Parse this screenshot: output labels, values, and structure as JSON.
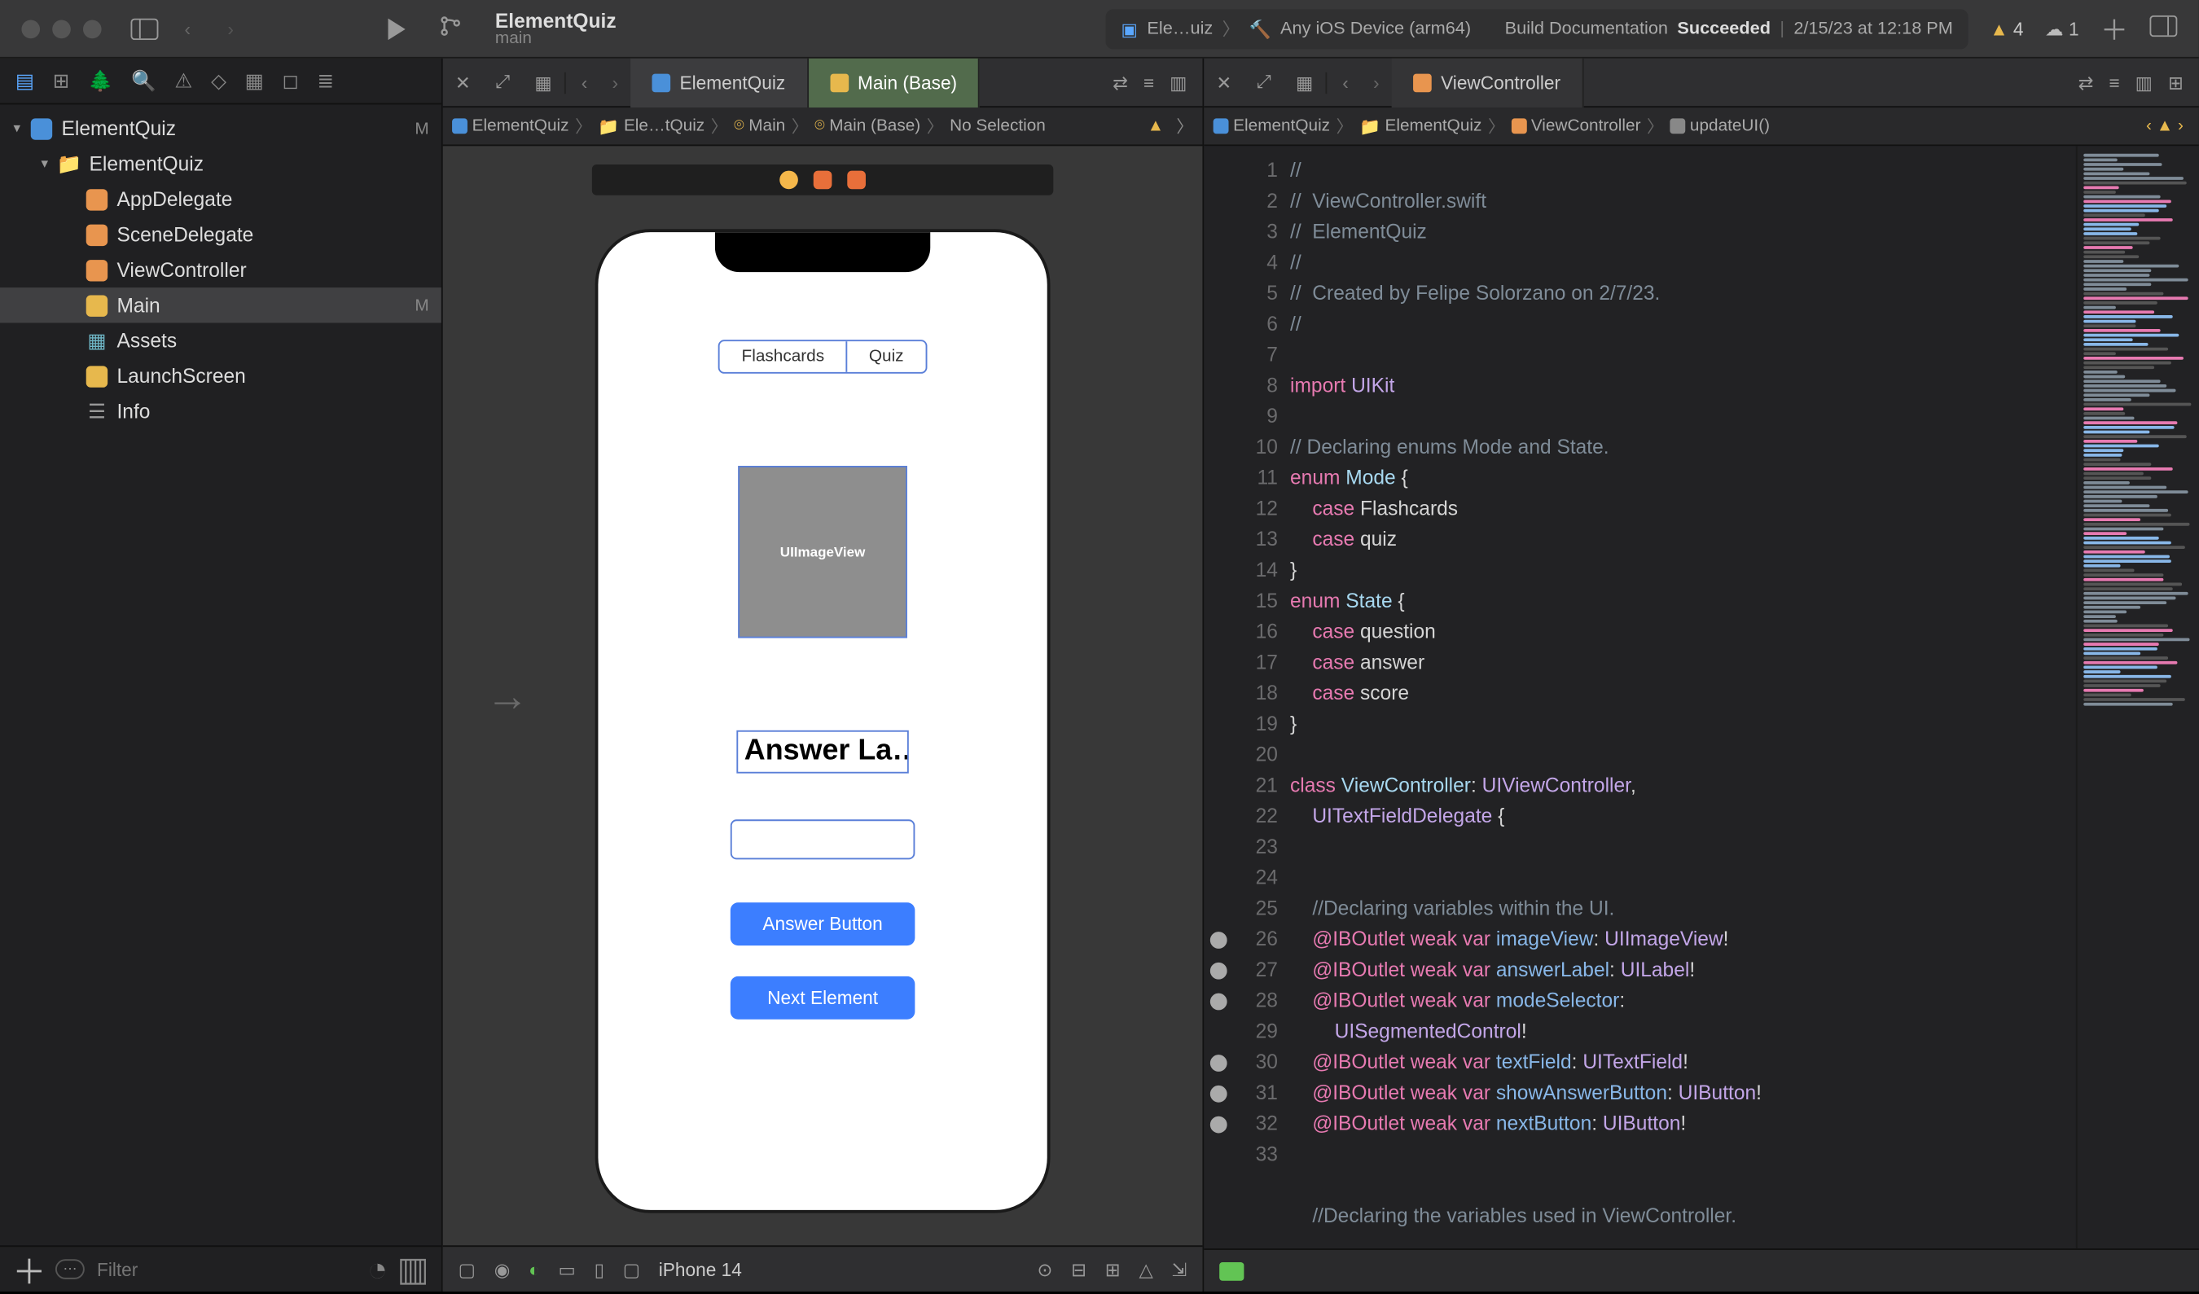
{
  "project": {
    "name": "ElementQuiz",
    "branch": "main"
  },
  "status": {
    "scheme": "Ele…uiz",
    "destination": "Any iOS Device (arm64)",
    "activity_pre": "Build Documentation ",
    "activity_strong": "Succeeded",
    "activity_time": "2/15/23 at 12:18 PM",
    "warnings": "4",
    "cloud": "1"
  },
  "navigator": {
    "rows": [
      {
        "label": "ElementQuiz",
        "indent": 0,
        "icon": "proj",
        "disclosure": "▾",
        "status": "M"
      },
      {
        "label": "ElementQuiz",
        "indent": 1,
        "icon": "fold",
        "disclosure": "▾",
        "status": ""
      },
      {
        "label": "AppDelegate",
        "indent": 2,
        "icon": "swift",
        "status": ""
      },
      {
        "label": "SceneDelegate",
        "indent": 2,
        "icon": "swift",
        "status": ""
      },
      {
        "label": "ViewController",
        "indent": 2,
        "icon": "swift",
        "status": ""
      },
      {
        "label": "Main",
        "indent": 2,
        "icon": "ib",
        "status": "M",
        "selected": true
      },
      {
        "label": "Assets",
        "indent": 2,
        "icon": "asset",
        "status": ""
      },
      {
        "label": "LaunchScreen",
        "indent": 2,
        "icon": "ib",
        "status": ""
      },
      {
        "label": "Info",
        "indent": 2,
        "icon": "plist",
        "status": ""
      }
    ],
    "filter_placeholder": "Filter"
  },
  "editor_left": {
    "tab_inactive": "ElementQuiz",
    "tab_active": "Main (Base)",
    "jump": [
      "ElementQuiz",
      "Ele…tQuiz",
      "Main",
      "Main (Base)",
      "No Selection"
    ],
    "phone": {
      "seg": [
        "Flashcards",
        "Quiz"
      ],
      "imageview": "UIImageView",
      "answer": "Answer La…",
      "btn1": "Answer Button",
      "btn2": "Next Element"
    },
    "bottom_device": "iPhone 14"
  },
  "editor_right": {
    "tab": "ViewController",
    "jump": [
      "ElementQuiz",
      "ElementQuiz",
      "ViewController",
      "updateUI()"
    ],
    "lines": [
      {
        "n": 1,
        "outlet": "",
        "h": "<span class='c-comment'>//</span>"
      },
      {
        "n": 2,
        "outlet": "",
        "h": "<span class='c-comment'>//  ViewController.swift</span>"
      },
      {
        "n": 3,
        "outlet": "",
        "h": "<span class='c-comment'>//  ElementQuiz</span>"
      },
      {
        "n": 4,
        "outlet": "",
        "h": "<span class='c-comment'>//</span>"
      },
      {
        "n": 5,
        "outlet": "",
        "h": "<span class='c-comment'>//  Created by Felipe Solorzano on 2/7/23.</span>"
      },
      {
        "n": 6,
        "outlet": "",
        "h": "<span class='c-comment'>//</span>"
      },
      {
        "n": 7,
        "outlet": "",
        "h": ""
      },
      {
        "n": 8,
        "outlet": "",
        "h": "<span class='c-kw'>import</span> <span class='c-type2'>UIKit</span>"
      },
      {
        "n": 9,
        "outlet": "",
        "h": ""
      },
      {
        "n": 10,
        "outlet": "",
        "h": "<span class='c-comment'>// Declaring enums Mode and State.</span>"
      },
      {
        "n": 11,
        "outlet": "",
        "h": "<span class='c-kw'>enum</span> <span class='c-type'>Mode</span> {"
      },
      {
        "n": 12,
        "outlet": "",
        "h": "    <span class='c-kw'>case</span> Flashcards"
      },
      {
        "n": 13,
        "outlet": "",
        "h": "    <span class='c-kw'>case</span> quiz"
      },
      {
        "n": 14,
        "outlet": "",
        "h": "}"
      },
      {
        "n": 15,
        "outlet": "",
        "h": "<span class='c-kw'>enum</span> <span class='c-type'>State</span> {"
      },
      {
        "n": 16,
        "outlet": "",
        "h": "    <span class='c-kw'>case</span> question"
      },
      {
        "n": 17,
        "outlet": "",
        "h": "    <span class='c-kw'>case</span> answer"
      },
      {
        "n": 18,
        "outlet": "",
        "h": "    <span class='c-kw'>case</span> score"
      },
      {
        "n": 19,
        "outlet": "",
        "h": "}"
      },
      {
        "n": 20,
        "outlet": "",
        "h": ""
      },
      {
        "n": 21,
        "outlet": "",
        "h": "<span class='c-kw'>class</span> <span class='c-type'>ViewController</span>: <span class='c-type2'>UIViewController</span>,\n    <span class='c-type2'>UITextFieldDelegate</span> {"
      },
      {
        "n": 22,
        "outlet": "",
        "h": ""
      },
      {
        "n": 23,
        "outlet": "",
        "h": ""
      },
      {
        "n": 24,
        "outlet": "",
        "h": "    <span class='c-comment'>//Declaring variables within the UI.</span>"
      },
      {
        "n": 25,
        "outlet": "●",
        "h": "    <span class='c-attr'>@IBOutlet</span> <span class='c-kw'>weak</span> <span class='c-kw'>var</span> <span class='c-id'>imageView</span>: <span class='c-type2'>UIImageView</span>!"
      },
      {
        "n": 26,
        "outlet": "●",
        "h": "    <span class='c-attr'>@IBOutlet</span> <span class='c-kw'>weak</span> <span class='c-kw'>var</span> <span class='c-id'>answerLabel</span>: <span class='c-type2'>UILabel</span>!"
      },
      {
        "n": 27,
        "outlet": "●",
        "h": "    <span class='c-attr'>@IBOutlet</span> <span class='c-kw'>weak</span> <span class='c-kw'>var</span> <span class='c-id'>modeSelector</span>:\n        <span class='c-type2'>UISegmentedControl</span>!"
      },
      {
        "n": 28,
        "outlet": "●",
        "h": "    <span class='c-attr'>@IBOutlet</span> <span class='c-kw'>weak</span> <span class='c-kw'>var</span> <span class='c-id'>textField</span>: <span class='c-type2'>UITextField</span>!"
      },
      {
        "n": 29,
        "outlet": "●",
        "h": "    <span class='c-attr'>@IBOutlet</span> <span class='c-kw'>weak</span> <span class='c-kw'>var</span> <span class='c-id'>showAnswerButton</span>: <span class='c-type2'>UIButton</span>!"
      },
      {
        "n": 30,
        "outlet": "●",
        "h": "    <span class='c-attr'>@IBOutlet</span> <span class='c-kw'>weak</span> <span class='c-kw'>var</span> <span class='c-id'>nextButton</span>: <span class='c-type2'>UIButton</span>!"
      },
      {
        "n": 31,
        "outlet": "",
        "h": ""
      },
      {
        "n": 32,
        "outlet": "",
        "h": ""
      },
      {
        "n": 33,
        "outlet": "",
        "h": "    <span class='c-comment'>//Declaring the variables used in ViewController.</span>"
      }
    ]
  }
}
